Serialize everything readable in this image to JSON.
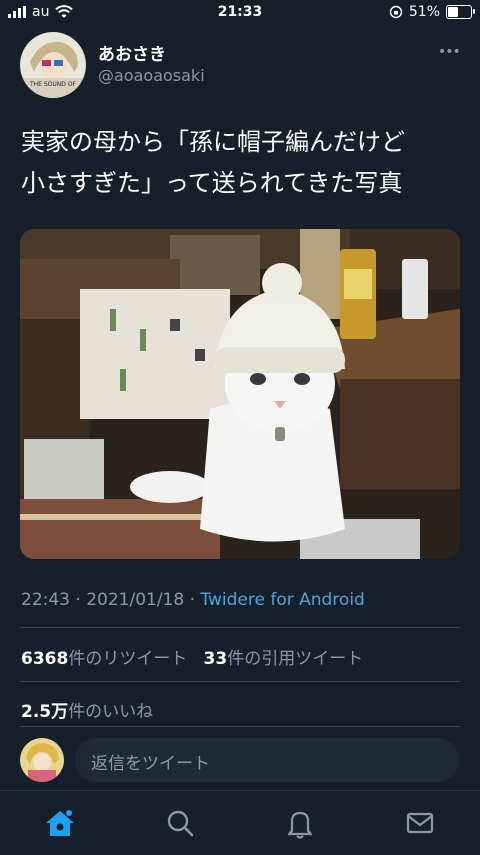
{
  "status_bar": {
    "carrier": "au",
    "time": "21:33",
    "battery": "51%",
    "battery_level": 0.51
  },
  "tweet": {
    "display_name": "あおさき",
    "handle": "@aoaoaosaki",
    "text_line1": "実家の母から「孫に帽子編んだけど",
    "text_line2": "小さすぎた」って送られてきた写真",
    "timestamp": "22:43 · 2021/01/18 · ",
    "source": "Twidere for Android",
    "retweets_count": "6368",
    "retweets_label": "件のリツイート",
    "quotes_count": "33",
    "quotes_label": "件の引用ツイート",
    "likes_count": "2.5万",
    "likes_label": "件のいいね",
    "avatar_text": "THE SOUND OF"
  },
  "reply": {
    "placeholder": "返信をツイート"
  },
  "colors": {
    "background": "#15202b",
    "accent": "#1da1f2",
    "muted": "#8899a6",
    "link": "#4aa3df"
  },
  "tabs": [
    {
      "name": "home-icon",
      "active": true
    },
    {
      "name": "search-icon",
      "active": false
    },
    {
      "name": "bell-icon",
      "active": false
    },
    {
      "name": "mail-icon",
      "active": false
    }
  ]
}
